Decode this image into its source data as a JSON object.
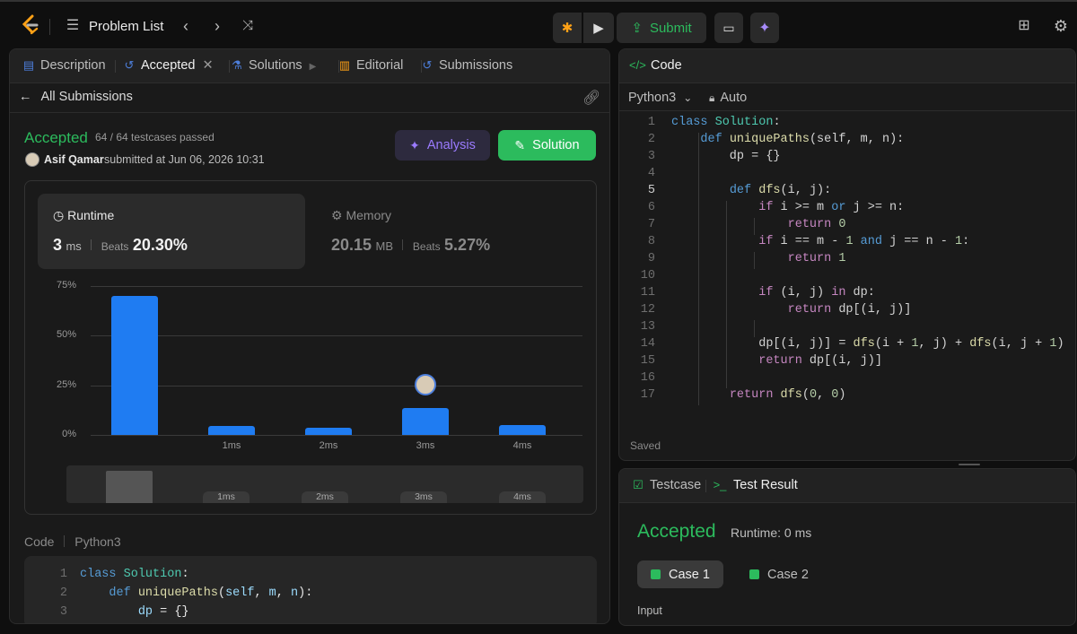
{
  "topbar": {
    "problem_list_label": "Problem List",
    "submit_label": "Submit"
  },
  "left_tabs": [
    {
      "label": "Description"
    },
    {
      "label": "Accepted"
    },
    {
      "label": "Solutions"
    },
    {
      "label": "Editorial"
    },
    {
      "label": "Submissions"
    }
  ],
  "submission": {
    "back_label": "All Submissions",
    "status": "Accepted",
    "testcases": "64 / 64 testcases passed",
    "user": "Asif Qamar",
    "submitted_text": "submitted at Jun 06, 2026 10:31",
    "analysis_label": "Analysis",
    "solution_label": "Solution"
  },
  "stats": {
    "runtime_label": "Runtime",
    "runtime_value": "3",
    "runtime_unit": "ms",
    "beats_label": "Beats",
    "runtime_beats": "20.30%",
    "memory_label": "Memory",
    "memory_value": "20.15",
    "memory_unit": "MB",
    "memory_beats": "5.27%"
  },
  "chart_data": {
    "type": "bar",
    "categories": [
      "",
      "1ms",
      "2ms",
      "3ms",
      "4ms"
    ],
    "values": [
      70,
      4.5,
      3.5,
      13.5,
      5
    ],
    "yticks": [
      "75%",
      "50%",
      "25%",
      "0%"
    ],
    "ylim": [
      0,
      75
    ],
    "highlight_category": "3ms",
    "bar_color": "#1f7cf2"
  },
  "mini_chart_labels": [
    "1ms",
    "2ms",
    "3ms",
    "4ms"
  ],
  "left_code": {
    "label": "Code",
    "language": "Python3",
    "lines": [
      "class Solution:",
      "    def uniquePaths(self, m, n):",
      "        dp = {}"
    ]
  },
  "code_panel": {
    "title": "Code",
    "language": "Python3",
    "auto_label": "Auto",
    "saved_label": "Saved",
    "lines": [
      "class Solution:",
      "    def uniquePaths(self, m, n):",
      "        dp = {}",
      "",
      "        def dfs(i, j):",
      "            if i >= m or j >= n:",
      "                return 0",
      "            if i == m - 1 and j == n - 1:",
      "                return 1",
      "",
      "            if (i, j) in dp:",
      "                return dp[(i, j)]",
      "",
      "            dp[(i, j)] = dfs(i + 1, j) + dfs(i, j + 1)",
      "            return dp[(i, j)]",
      "",
      "        return dfs(0, 0)"
    ]
  },
  "result_panel": {
    "testcase_tab": "Testcase",
    "result_tab": "Test Result",
    "status": "Accepted",
    "runtime": "Runtime: 0 ms",
    "cases": [
      "Case 1",
      "Case 2"
    ],
    "input_label": "Input"
  }
}
